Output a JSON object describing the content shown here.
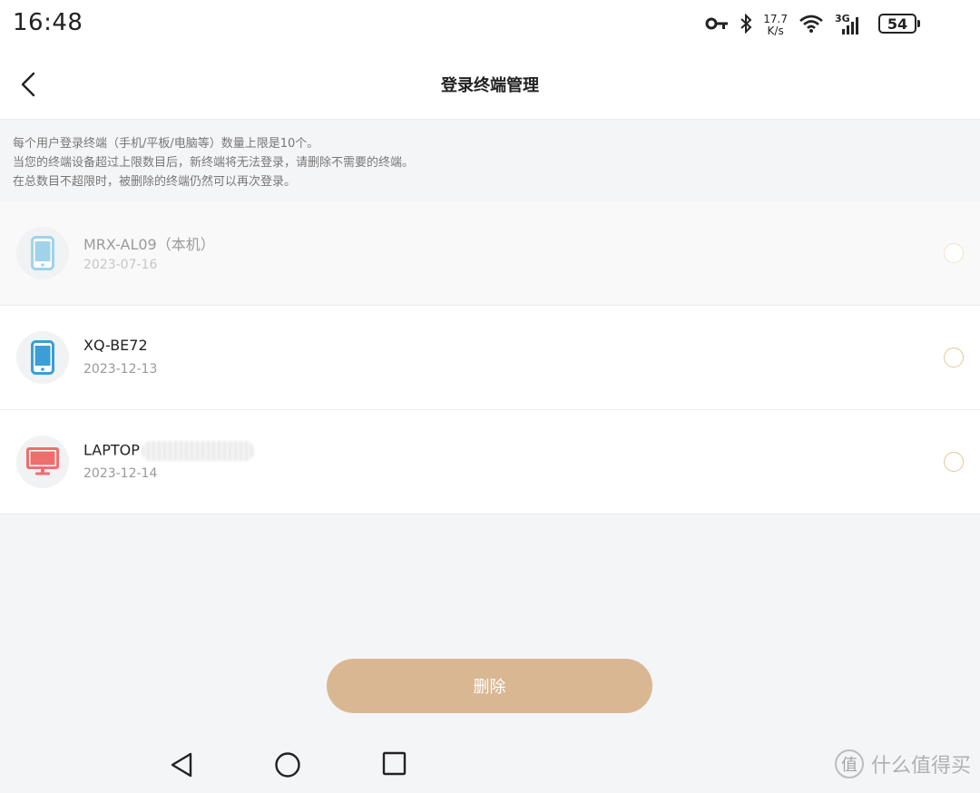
{
  "status_bar": {
    "time": "16:48",
    "net_speed_value": "17.7",
    "net_speed_unit": "K/s",
    "network_type": "3G",
    "battery": "54"
  },
  "header": {
    "title": "登录终端管理"
  },
  "notice": {
    "line1": "每个用户登录终端（手机/平板/电脑等）数量上限是10个。",
    "line2": "当您的终端设备超过上限数目后，新终端将无法登录，请删除不需要的终端。",
    "line3": "在总数目不超限时，被删除的终端仍然可以再次登录。"
  },
  "devices": [
    {
      "name": "MRX-AL09（本机）",
      "date": "2023-07-16",
      "type": "phone-icon",
      "icon_color": "#9fd3ea"
    },
    {
      "name": "XQ-BE72",
      "date": "2023-12-13",
      "type": "phone-icon",
      "icon_color": "#3a9fd6"
    },
    {
      "name": "LAPTOP",
      "date": "2023-12-14",
      "type": "monitor-icon",
      "icon_color": "#ee6e6e"
    }
  ],
  "actions": {
    "delete_label": "删除"
  },
  "watermark": {
    "logo": "值",
    "text": "什么值得买"
  },
  "colors": {
    "accent": "#d8b792",
    "radio_border": "#e2c796"
  }
}
